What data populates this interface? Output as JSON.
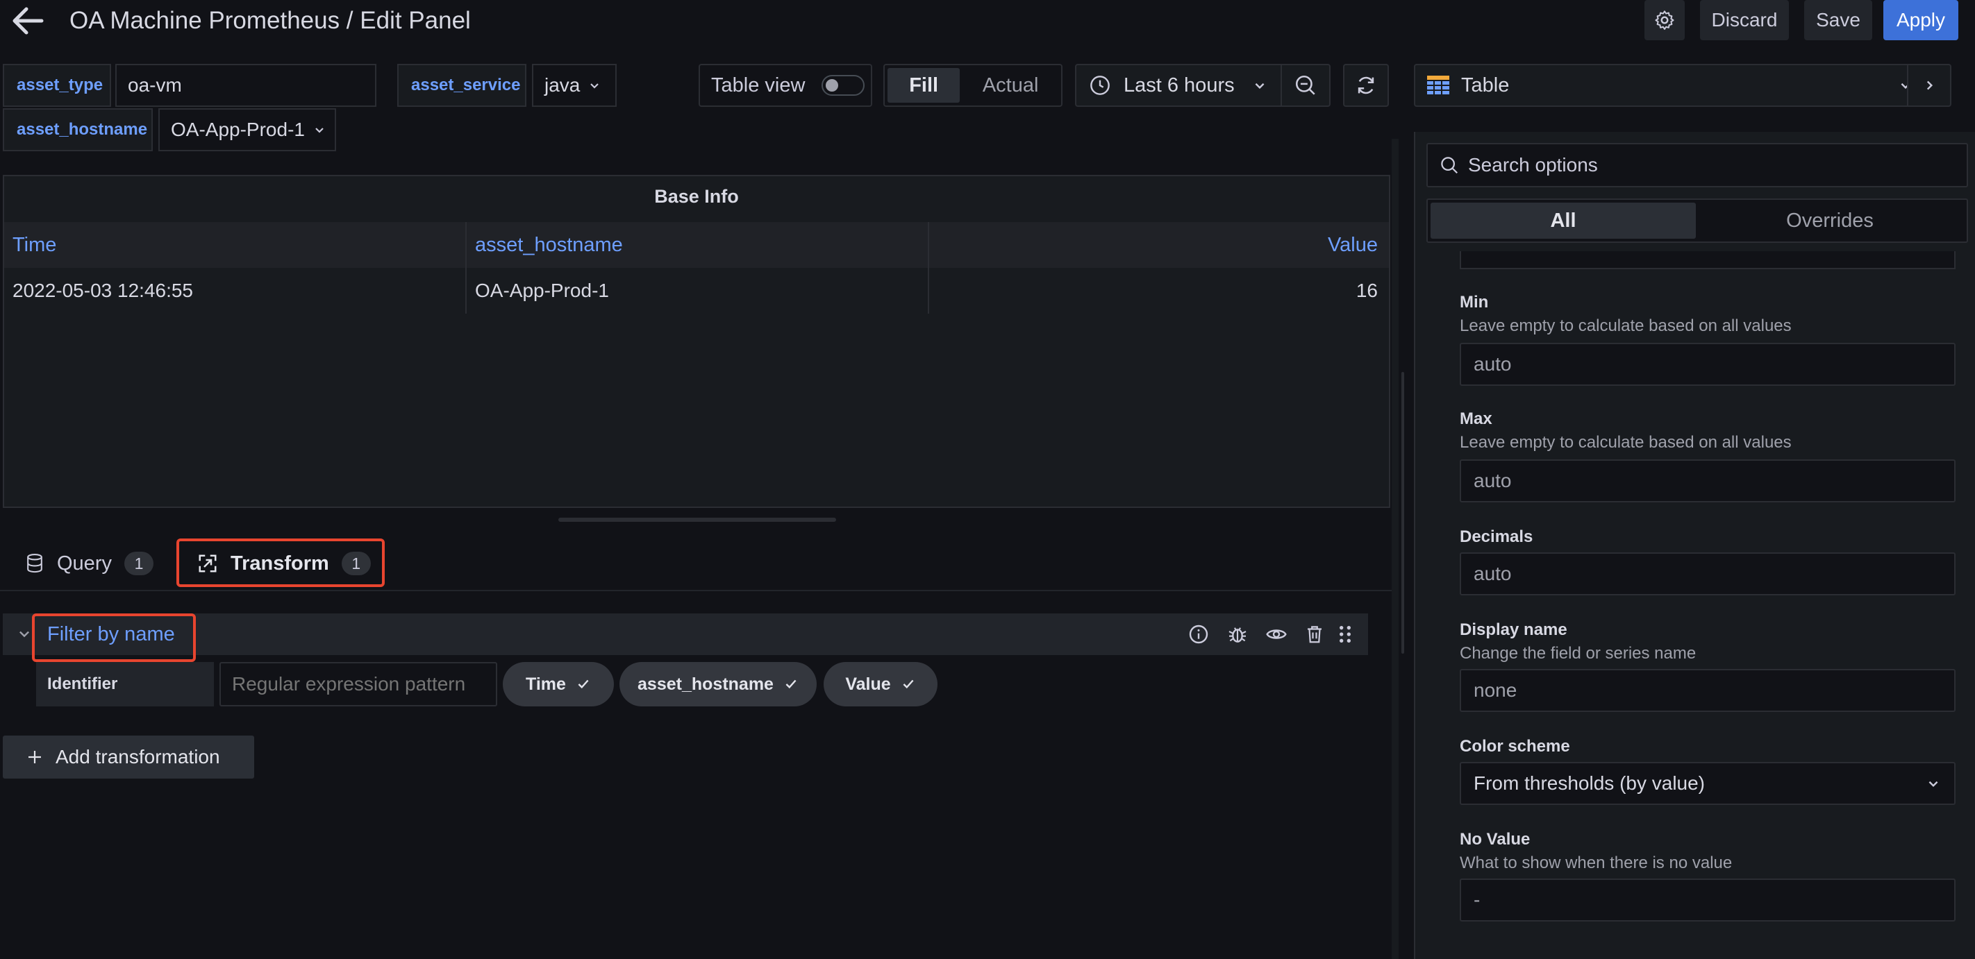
{
  "header": {
    "title": "OA Machine Prometheus / Edit Panel",
    "discard_label": "Discard",
    "save_label": "Save",
    "apply_label": "Apply"
  },
  "variables": {
    "asset_type": {
      "label": "asset_type",
      "value": "oa-vm"
    },
    "asset_service": {
      "label": "asset_service",
      "value": "java"
    },
    "asset_hostname": {
      "label": "asset_hostname",
      "value": "OA-App-Prod-1"
    }
  },
  "toolbar": {
    "table_view_label": "Table view",
    "table_view_on": false,
    "fill_label": "Fill",
    "actual_label": "Actual",
    "time_range": "Last 6 hours"
  },
  "panel": {
    "title": "Base Info",
    "columns": [
      "Time",
      "asset_hostname",
      "Value"
    ],
    "rows": [
      [
        "2022-05-03 12:46:55",
        "OA-App-Prod-1",
        "16"
      ]
    ]
  },
  "tabs": {
    "query": {
      "label": "Query",
      "count": "1"
    },
    "transform": {
      "label": "Transform",
      "count": "1"
    }
  },
  "transform": {
    "name": "Filter by name",
    "identifier_label": "Identifier",
    "regex_placeholder": "Regular expression pattern",
    "chips": [
      "Time",
      "asset_hostname",
      "Value"
    ],
    "add_label": "Add transformation"
  },
  "visualization": {
    "name": "Table"
  },
  "options": {
    "search_placeholder": "Search options",
    "tab_all": "All",
    "tab_overrides": "Overrides",
    "min": {
      "label": "Min",
      "desc": "Leave empty to calculate based on all values",
      "value": "auto"
    },
    "max": {
      "label": "Max",
      "desc": "Leave empty to calculate based on all values",
      "value": "auto"
    },
    "decimals": {
      "label": "Decimals",
      "value": "auto"
    },
    "display_name": {
      "label": "Display name",
      "desc": "Change the field or series name",
      "value": "none"
    },
    "color_scheme": {
      "label": "Color scheme",
      "value": "From thresholds (by value)"
    },
    "no_value": {
      "label": "No Value",
      "desc": "What to show when there is no value",
      "value": "-"
    }
  },
  "colors": {
    "background": "#111217",
    "panel": "#181b1f",
    "accent_blue": "#6e9fff",
    "apply_blue": "#3d71d9",
    "highlight_red": "#e8452f"
  }
}
